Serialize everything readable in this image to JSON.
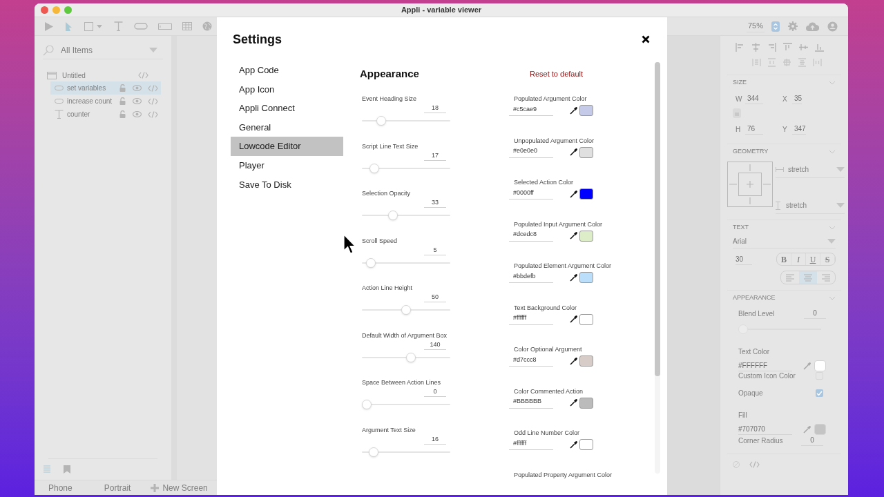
{
  "window": {
    "title": "Appli - variable viewer"
  },
  "toolbar": {
    "zoom": "75%"
  },
  "layers": {
    "search_placeholder": "All Items",
    "items": [
      {
        "label": "Untitled",
        "kind": "screen",
        "selected": false,
        "children": [
          {
            "label": "set variables",
            "kind": "button",
            "selected": true
          },
          {
            "label": "increase count",
            "kind": "button",
            "selected": false
          },
          {
            "label": "counter",
            "kind": "text",
            "selected": false
          }
        ]
      }
    ]
  },
  "bottom_bar": {
    "device": "Phone",
    "orientation": "Portrait",
    "new_screen": "New Screen"
  },
  "inspector": {
    "size": {
      "title": "SIZE",
      "fields": [
        {
          "label": "W",
          "value": "344"
        },
        {
          "label": "X",
          "value": "35"
        },
        {
          "label": "H",
          "value": "76"
        },
        {
          "label": "Y",
          "value": "347"
        }
      ]
    },
    "geometry": {
      "title": "GEOMETRY",
      "horizontal": "stretch",
      "vertical": "stretch"
    },
    "text": {
      "title": "TEXT",
      "font": "Arial",
      "size": "30",
      "styles": [
        {
          "label": "B",
          "kind": "bold"
        },
        {
          "label": "I",
          "kind": "italic"
        },
        {
          "label": "U",
          "kind": "underline"
        },
        {
          "label": "S",
          "kind": "strike"
        }
      ],
      "alignments": [
        {
          "kind": "left",
          "selected": false
        },
        {
          "kind": "center",
          "selected": true
        },
        {
          "kind": "right",
          "selected": false
        }
      ]
    },
    "appearance": {
      "title": "APPEARANCE",
      "rows": [
        {
          "kind": "slider",
          "label": "Blend Level",
          "value": "0",
          "level": 0
        },
        {
          "kind": "color",
          "label": "Text Color",
          "value": "#FFFFFF",
          "color": "#ffffff"
        },
        {
          "kind": "checkbox",
          "label": "Custom Icon Color",
          "checked": false
        },
        {
          "kind": "checkbox",
          "label": "Opaque",
          "checked": true
        },
        {
          "kind": "color",
          "label": "Fill",
          "value": "#707070",
          "color": "#c4c4c4"
        },
        {
          "kind": "number",
          "label": "Corner Radius",
          "value": "0"
        }
      ]
    }
  },
  "settings": {
    "title": "Settings",
    "nav": [
      {
        "label": "App Code",
        "selected": false
      },
      {
        "label": "App Icon",
        "selected": false
      },
      {
        "label": "Appli Connect",
        "selected": false
      },
      {
        "label": "General",
        "selected": false
      },
      {
        "label": "Lowcode Editor",
        "selected": true
      },
      {
        "label": "Player",
        "selected": false
      },
      {
        "label": "Save To Disk",
        "selected": false
      }
    ],
    "section_title": "Appearance",
    "reset": "Reset to default",
    "sliders": [
      {
        "label": "Event Heading Size",
        "value": "18",
        "level": 0.18
      },
      {
        "label": "Script Line Text Size",
        "value": "17",
        "level": 0.1
      },
      {
        "label": "Selection Opacity",
        "value": "33",
        "level": 0.33
      },
      {
        "label": "Scroll Speed",
        "value": "5",
        "level": 0.05
      },
      {
        "label": "Action Line Height",
        "value": "50",
        "level": 0.5
      },
      {
        "label": "Default Width of Argument Box",
        "value": "140",
        "level": 0.56
      },
      {
        "label": "Space Between Action Lines",
        "value": "0",
        "level": 0
      },
      {
        "label": "Argument Text Size",
        "value": "16",
        "level": 0.09
      }
    ],
    "colors": [
      {
        "label": "Populated Argument Color",
        "value": "#c5cae9",
        "color": "#c5cae9"
      },
      {
        "label": "Unpopulated Argument Color",
        "value": "#e0e0e0",
        "color": "#e0e0e0"
      },
      {
        "label": "Selected Action Color",
        "value": "#0000ff",
        "color": "#0000ff"
      },
      {
        "label": "Populated Input Argument Color",
        "value": "#dcedc8",
        "color": "#dcedc8"
      },
      {
        "label": "Populated Element Argument Color",
        "value": "#bbdefb",
        "color": "#bbdefb"
      },
      {
        "label": "Text Background Color",
        "value": "#ffffff",
        "color": "#ffffff"
      },
      {
        "label": "Color Optional Argument",
        "value": "#d7ccc8",
        "color": "#d7ccc8"
      },
      {
        "label": "Color Commented Action",
        "value": "#BBBBBB",
        "color": "#bbbbbb"
      },
      {
        "label": "Odd Line Number Color",
        "value": "#ffffff",
        "color": "#ffffff"
      },
      {
        "label": "Populated Property Argument Color"
      }
    ]
  }
}
